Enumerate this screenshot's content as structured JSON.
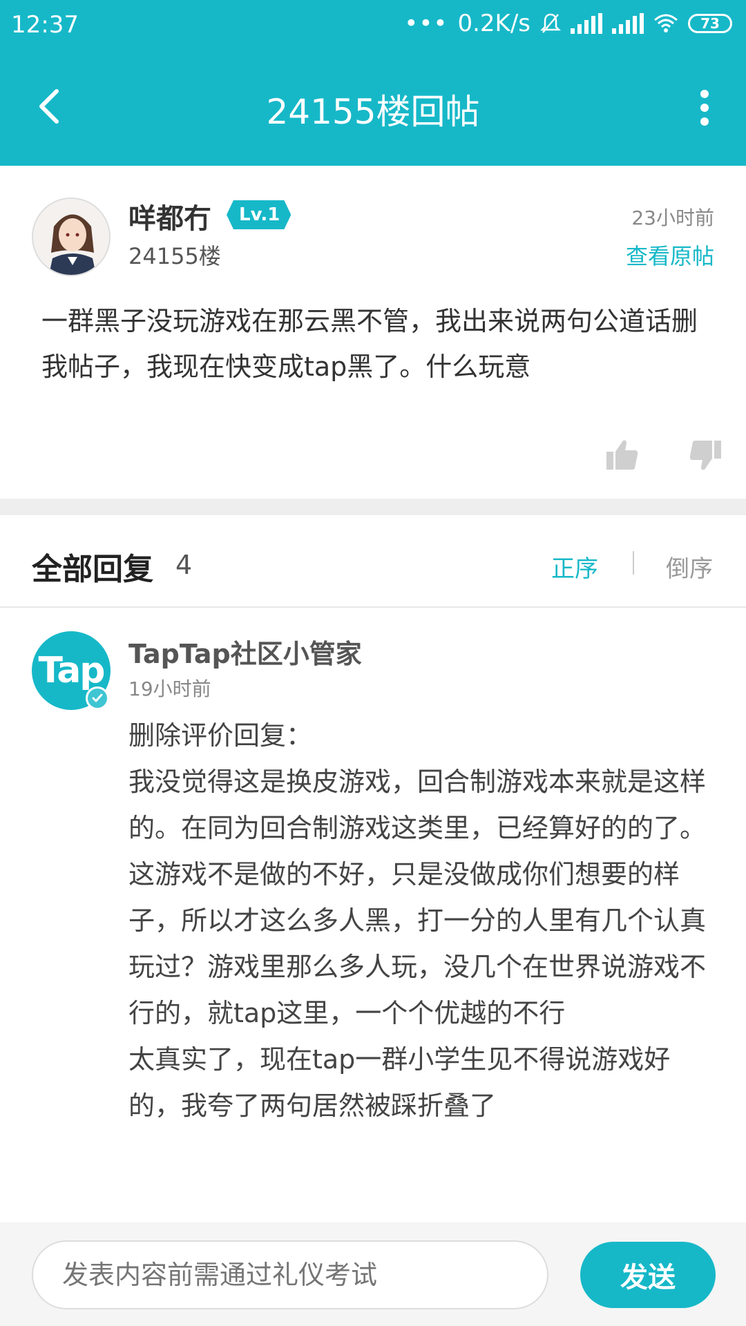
{
  "status_bar": {
    "time": "12:37",
    "network_speed": "0.2K/s",
    "battery": "73",
    "icons": [
      "mute-icon",
      "signal-icon",
      "hd-signal-icon",
      "wifi-icon",
      "battery-icon"
    ]
  },
  "app_bar": {
    "title": "24155楼回帖",
    "back_icon": "chevron-left-icon",
    "more_icon": "more-vertical-icon"
  },
  "post": {
    "author": "咩都冇",
    "level": "Lv.1",
    "floor": "24155楼",
    "time": "23小时前",
    "view_original": "查看原帖",
    "content": "一群黑子没玩游戏在那云黑不管，我出来说两句公道话删我帖子，我现在快变成tap黑了。什么玩意",
    "like_icon": "thumbs-up-icon",
    "dislike_icon": "thumbs-down-icon"
  },
  "replies": {
    "title": "全部回复",
    "count": "4",
    "sort_asc": "正序",
    "sort_desc": "倒序",
    "items": [
      {
        "avatar_text": "Tap",
        "name": "TapTap社区小管家",
        "time": "19小时前",
        "lines": [
          "删除评价回复：",
          "我没觉得这是换皮游戏，回合制游戏本来就是这样的。在同为回合制游戏这类里，已经算好的的了。这游戏不是做的不好，只是没做成你们想要的样子，所以才这么多人黑，打一分的人里有几个认真玩过？游戏里那么多人玩，没几个在世界说游戏不行的，就tap这里，一个个优越的不行",
          "太真实了，现在tap一群小学生见不得说游戏好的，我夸了两句居然被踩折叠了"
        ]
      }
    ]
  },
  "input_bar": {
    "placeholder": "发表内容前需通过礼仪考试",
    "send_label": "发送"
  },
  "colors": {
    "accent": "#16b8c8",
    "text_primary": "#333333",
    "text_secondary": "#888888"
  }
}
